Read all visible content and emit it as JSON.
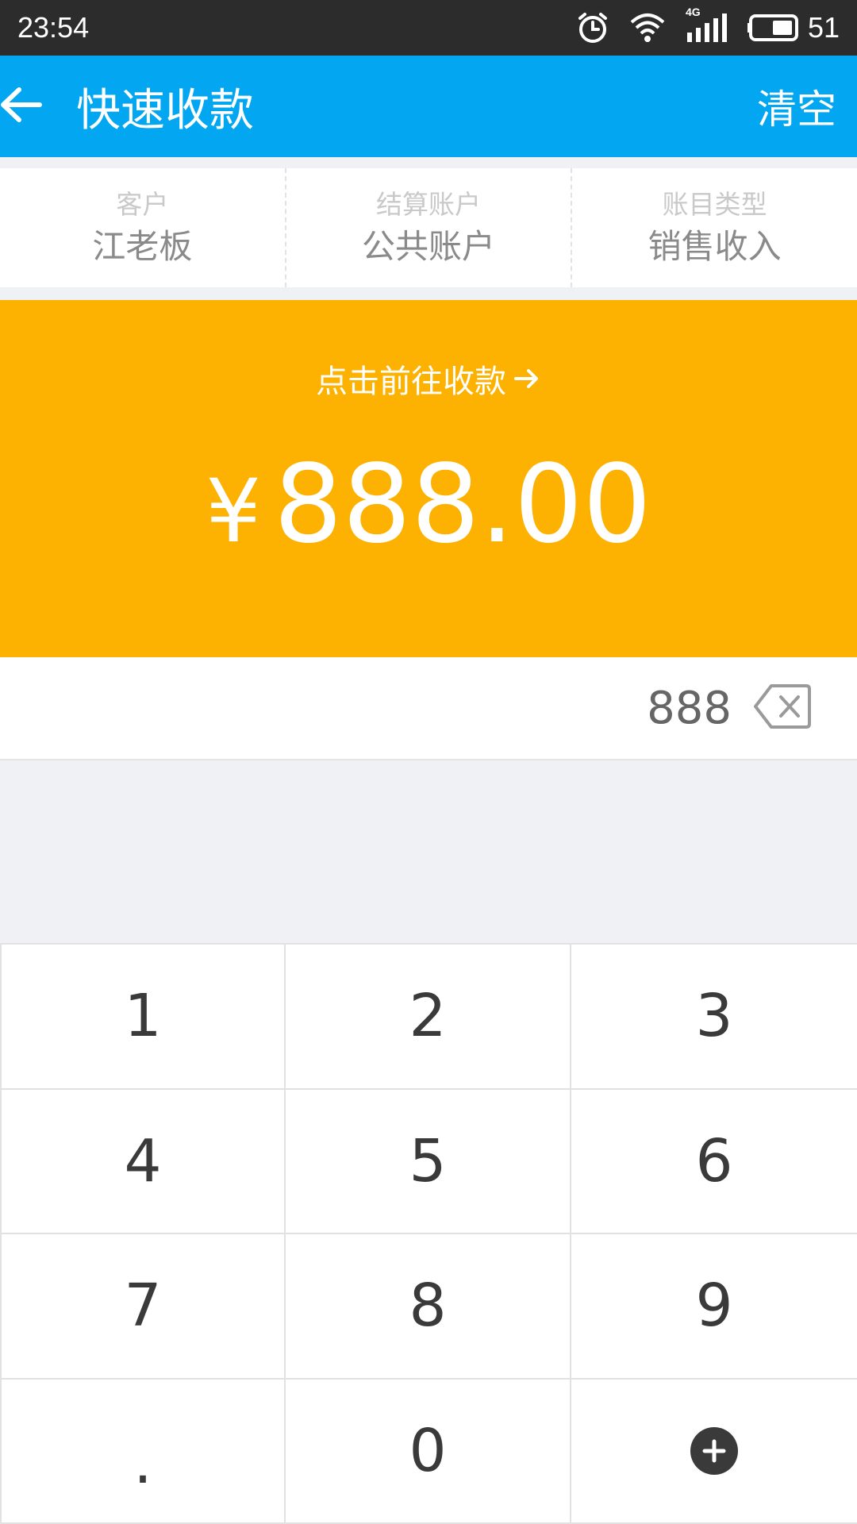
{
  "status_bar": {
    "time": "23:54",
    "network": "4G",
    "battery": "51",
    "icons": [
      "alarm-icon",
      "wifi-icon",
      "signal-icon",
      "battery-icon"
    ]
  },
  "app_bar": {
    "title": "快速收款",
    "action": "清空",
    "back_icon": "arrow-left-icon",
    "color": "#02a6f1"
  },
  "info": {
    "customer_label": "客户",
    "customer_value": "江老板",
    "account_label": "结算账户",
    "account_value": "公共账户",
    "type_label": "账目类型",
    "type_value": "销售收入"
  },
  "amount_panel": {
    "link_text": "点击前往收款",
    "link_icon": "arrow-right-icon",
    "currency": "¥",
    "amount": "888.00",
    "color": "#fdb100"
  },
  "input": {
    "value": "888",
    "delete_icon": "backspace-icon"
  },
  "keypad": {
    "keys": [
      "1",
      "2",
      "3",
      "4",
      "5",
      "6",
      "7",
      "8",
      "9",
      ".",
      "0"
    ],
    "plus_icon": "plus-circle-icon"
  }
}
